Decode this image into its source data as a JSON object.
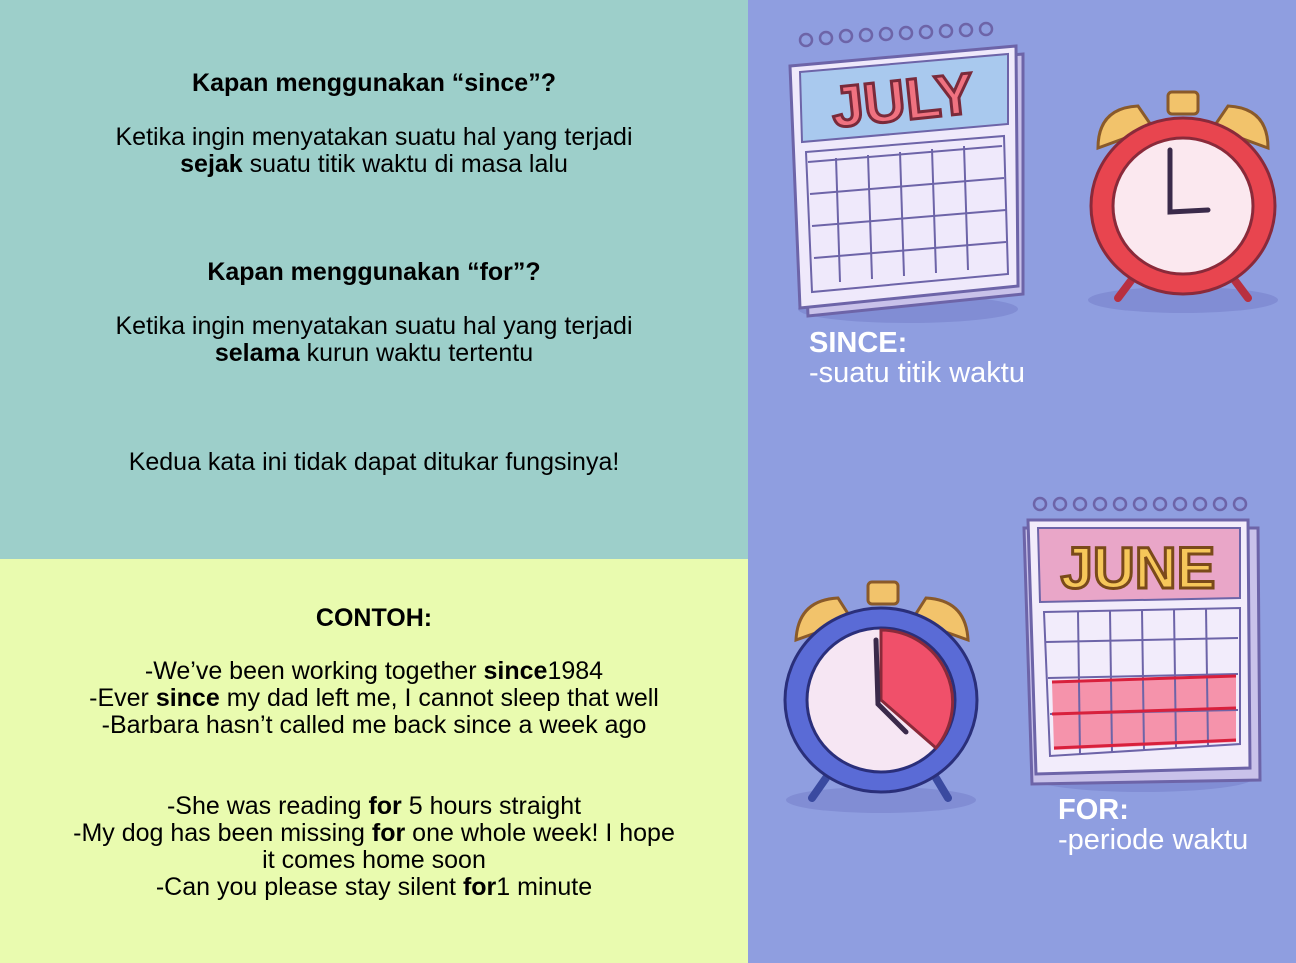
{
  "rules": {
    "since_heading": "Kapan menggunakan “since”?",
    "since_line1": "Ketika ingin menyatakan suatu hal yang terjadi",
    "since_line2_bold": "sejak",
    "since_line2_rest": " suatu titik waktu di masa lalu",
    "for_heading": "Kapan menggunakan “for”?",
    "for_line1": "Ketika ingin menyatakan suatu hal yang terjadi",
    "for_line2_bold": "selama",
    "for_line2_rest": " kurun waktu tertentu",
    "note": "Kedua kata ini tidak dapat ditukar fungsinya!"
  },
  "examples": {
    "heading": "CONTOH:",
    "s1_a": "-We’ve been working together ",
    "s1_b": "since",
    "s1_c": "1984",
    "s2_a": "-Ever ",
    "s2_b": "since",
    "s2_c": " my dad left me, I cannot sleep that well",
    "s3": "-Barbara hasn’t called me back since a week ago",
    "f1_a": "-She was reading ",
    "f1_b": "for",
    "f1_c": " 5 hours straight",
    "f2_a": "-My dog has been missing ",
    "f2_b": "for",
    "f2_c": " one whole week! I hope",
    "f2_d": "it comes home soon",
    "f3_a": "-Can you please stay silent ",
    "f3_b": "for",
    "f3_c": "1 minute"
  },
  "illustrations": {
    "calendar_top_month": "JULY",
    "calendar_bottom_month": "JUNE",
    "since_caption_title": "SINCE:",
    "since_caption_text": "-suatu titik waktu",
    "for_caption_title": "FOR:",
    "for_caption_text": "-periode waktu",
    "icons": [
      "calendar-icon",
      "alarm-clock-icon"
    ]
  },
  "colors": {
    "teal_panel": "#9dcfca",
    "lime_panel": "#e9fbaf",
    "blue_panel": "#8f9ee0",
    "red_clock": "#e8454f",
    "blue_clock": "#5a6bd6",
    "bell_gold": "#f2c36b",
    "highlight_red": "#f0506a"
  }
}
